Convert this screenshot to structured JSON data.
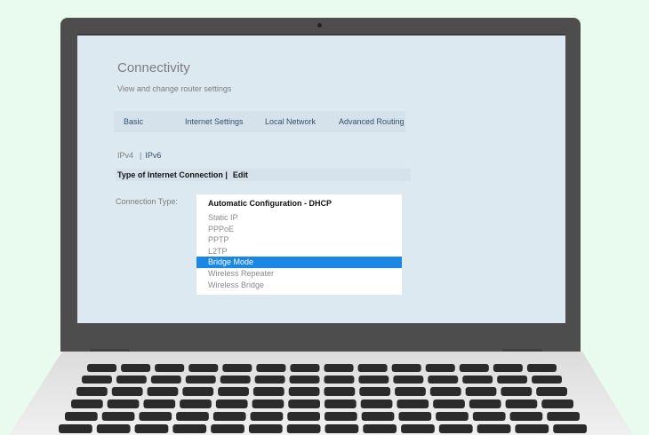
{
  "page": {
    "title": "Connectivity",
    "subtitle": "View and change router settings"
  },
  "tabs": [
    {
      "label": "Basic"
    },
    {
      "label": "Internet Settings"
    },
    {
      "label": "Local Network"
    },
    {
      "label": "Advanced Routing"
    }
  ],
  "subtabs": {
    "ipv4": "IPv4",
    "separator": "|",
    "ipv6": "IPv6",
    "active": "IPv6"
  },
  "section": {
    "label": "Type of Internet Connection |",
    "edit": "Edit"
  },
  "connection": {
    "label": "Connection Type:",
    "selected": "Automatic Configuration - DHCP",
    "options": [
      "Static IP",
      "PPPoE",
      "PPTP",
      "L2TP",
      "Bridge Mode",
      "Wireless Repeater",
      "Wireless Bridge"
    ],
    "highlighted": "Bridge Mode"
  },
  "colors": {
    "screen_bg": "#dde9f1",
    "highlight": "#1a86e6",
    "laptop_body": "#4d4d4d",
    "background": "#e8fbee"
  }
}
